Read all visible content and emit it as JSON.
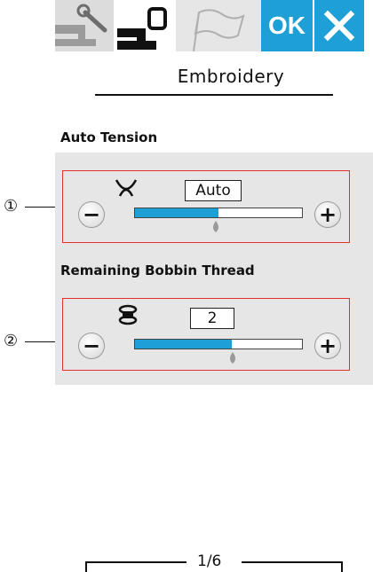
{
  "tabs": {
    "machine_icon": "wrench-sewing-machine-icon",
    "embroidery_icon": "embroidery-frame-icon",
    "flag_icon": "flag-icon",
    "ok_label": "OK",
    "close_icon": "close-icon"
  },
  "header": {
    "title": "Embroidery"
  },
  "auto_tension": {
    "label": "Auto Tension",
    "icon": "thread-tension-icon",
    "value": "Auto",
    "level_fraction": 0.5,
    "callout": "①"
  },
  "bobbin": {
    "label": "Remaining Bobbin Thread",
    "icon": "bobbin-icon",
    "value": "2",
    "level_fraction": 0.58,
    "callout": "②"
  },
  "pager": {
    "label": "1/6"
  },
  "colors": {
    "accent": "#1ea0d6",
    "panel_border": "#e03030",
    "band": "#e6e6e6"
  }
}
